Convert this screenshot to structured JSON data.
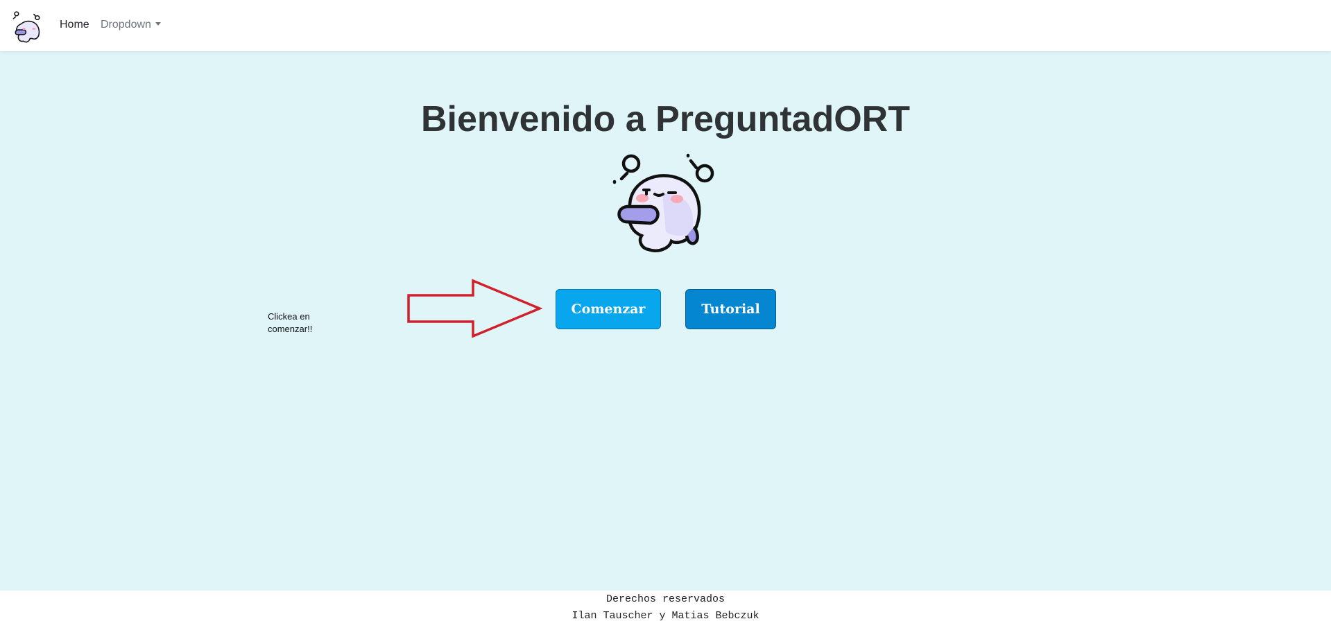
{
  "nav": {
    "home_label": "Home",
    "dropdown_label": "Dropdown",
    "logo_icon": "ghost-mascot-icon"
  },
  "main": {
    "title": "Bienvenido a PreguntadORT",
    "mascot_icon": "ghost-mascot-icon",
    "hint_text": "Clickea en comenzar!!",
    "arrow_icon": "right-arrow-icon",
    "start_button": "Comenzar",
    "tutorial_button": "Tutorial"
  },
  "footer": {
    "line1": "Derechos reservados",
    "line2": "Ilan Tauscher y Matias Bebczuk"
  },
  "colors": {
    "page_background": "#dff5f8",
    "start_button": "#08a6ec",
    "tutorial_button": "#0486d0",
    "arrow_outline": "#d0202a"
  }
}
